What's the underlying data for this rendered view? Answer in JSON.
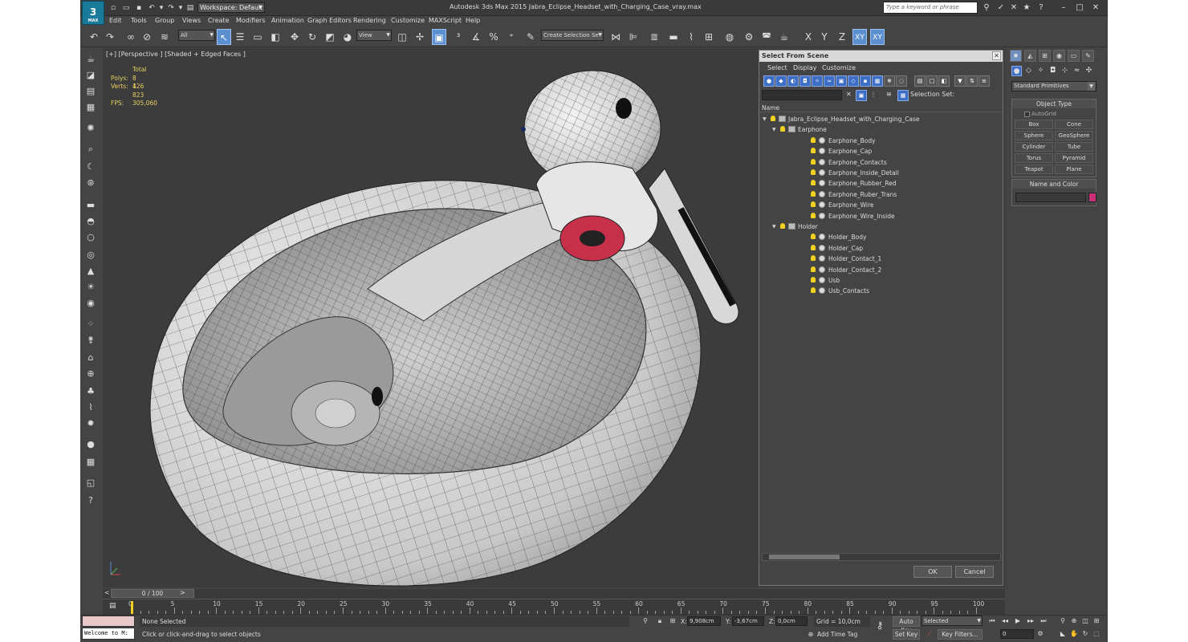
{
  "app": {
    "logo": "3",
    "logo_sub": "MAX",
    "title": "Autodesk 3ds Max  2015     Jabra_Eclipse_Headset_with_Charging_Case_vray.max",
    "workspace": "Workspace: Default",
    "search_placeholder": "Type a keyword or phrase"
  },
  "menu": [
    "Edit",
    "Tools",
    "Group",
    "Views",
    "Create",
    "Modifiers",
    "Animation",
    "Graph Editors",
    "Rendering",
    "Customize",
    "MAXScript",
    "Help"
  ],
  "toolbar": {
    "filter": "All",
    "refcoord": "View",
    "selection_set": "Create Selection Se",
    "axis_x": "X",
    "axis_y": "Y",
    "axis_z": "Z",
    "plane_xy": "XY",
    "plane_xy2": "XY"
  },
  "viewport": {
    "label": "[+] [Perspective ] [Shaded + Edged Faces ]",
    "stats_total": "Total",
    "polys_label": "Polys:",
    "polys": "8 126",
    "verts_label": "Verts:",
    "verts": "4 823",
    "fps_label": "FPS:",
    "fps": "305,060"
  },
  "dialog": {
    "title": "Select From Scene",
    "menu": [
      "Select",
      "Display",
      "Customize"
    ],
    "selection_set_label": "Selection Set:",
    "column_name": "Name",
    "tree": [
      {
        "level": 0,
        "expand": "▼",
        "type": "layer",
        "name": "Jabra_Eclipse_Headset_with_Charging_Case"
      },
      {
        "level": 1,
        "expand": "▼",
        "type": "layer",
        "name": "Earphone"
      },
      {
        "level": 2,
        "expand": "",
        "type": "object",
        "name": "Earphone_Body"
      },
      {
        "level": 2,
        "expand": "",
        "type": "object",
        "name": "Earphone_Cap"
      },
      {
        "level": 2,
        "expand": "",
        "type": "object",
        "name": "Earphone_Contacts"
      },
      {
        "level": 2,
        "expand": "",
        "type": "object",
        "name": "Earphone_Inside_Detail"
      },
      {
        "level": 2,
        "expand": "",
        "type": "object",
        "name": "Earphone_Rubber_Red"
      },
      {
        "level": 2,
        "expand": "",
        "type": "object",
        "name": "Earphone_Ruber_Trans"
      },
      {
        "level": 2,
        "expand": "",
        "type": "object",
        "name": "Earphone_Wire"
      },
      {
        "level": 2,
        "expand": "",
        "type": "object",
        "name": "Earphone_Wire_Inside"
      },
      {
        "level": 1,
        "expand": "▼",
        "type": "layer",
        "name": "Holder"
      },
      {
        "level": 2,
        "expand": "",
        "type": "object",
        "name": "Holder_Body"
      },
      {
        "level": 2,
        "expand": "",
        "type": "object",
        "name": "Holder_Cap"
      },
      {
        "level": 2,
        "expand": "",
        "type": "object",
        "name": "Holder_Contact_1"
      },
      {
        "level": 2,
        "expand": "",
        "type": "object",
        "name": "Holder_Contact_2"
      },
      {
        "level": 2,
        "expand": "",
        "type": "object",
        "name": "Usb"
      },
      {
        "level": 2,
        "expand": "",
        "type": "object",
        "name": "Usb_Contacts"
      }
    ],
    "ok": "OK",
    "cancel": "Cancel"
  },
  "command_panel": {
    "category": "Standard Primitives",
    "object_type": "Object Type",
    "autogrid": "AutoGrid",
    "buttons": [
      "Box",
      "Cone",
      "Sphere",
      "GeoSphere",
      "Cylinder",
      "Tube",
      "Torus",
      "Pyramid",
      "Teapot",
      "Plane"
    ],
    "name_and_color": "Name and Color",
    "color": "#c8307a"
  },
  "timeline": {
    "slider": "0 / 100",
    "ticks": [
      "0",
      "5",
      "10",
      "15",
      "20",
      "25",
      "30",
      "35",
      "40",
      "45",
      "50",
      "55",
      "60",
      "65",
      "70",
      "75",
      "80",
      "85",
      "90",
      "95",
      "100"
    ]
  },
  "status": {
    "maxscript": "Welcome to M:",
    "selected": "None Selected",
    "prompt": "Click or click-and-drag to select objects",
    "x_label": "X:",
    "x": "9,908cm",
    "y_label": "Y:",
    "y": "-3,67cm",
    "z_label": "Z:",
    "z": "0,0cm",
    "grid": "Grid = 10,0cm",
    "add_time_tag": "Add Time Tag",
    "auto_key": "Auto Key",
    "set_key": "Set Key",
    "key_mode": "Selected",
    "key_filters": "Key Filters...",
    "frame": "0"
  }
}
